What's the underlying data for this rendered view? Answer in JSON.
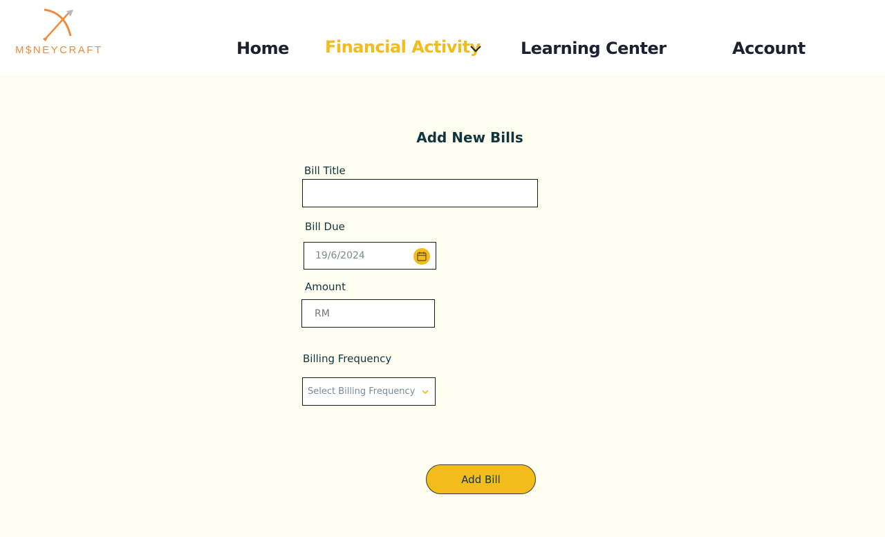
{
  "brand": {
    "logo_text": "M$NEYCRAFT",
    "accent": "#f08a3c"
  },
  "nav": {
    "home": "Home",
    "financial_activity": "Financial Activity",
    "learning_center": "Learning Center",
    "account": "Account",
    "active_color": "#f2bc1b"
  },
  "form": {
    "title": "Add New Bills",
    "bill_title_label": "Bill Title",
    "bill_title_value": "",
    "bill_due_label": "Bill Due",
    "bill_due_value": "19/6/2024",
    "amount_label": "Amount",
    "amount_placeholder": "RM",
    "frequency_label": "Billing Frequency",
    "frequency_placeholder": "Select Billing Frequency",
    "submit_label": "Add Bill"
  },
  "icons": {
    "calendar": "calendar-icon",
    "chevron": "chevron-down-icon",
    "logo": "bow-arrow-icon"
  }
}
